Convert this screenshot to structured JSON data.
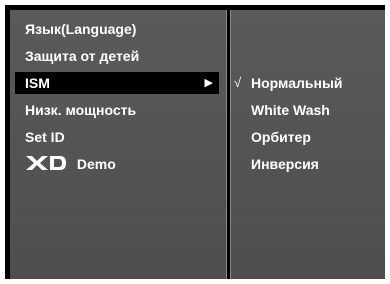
{
  "menu": {
    "items": [
      {
        "label": "Язык(Language)"
      },
      {
        "label": "Защита от детей"
      },
      {
        "label": "ISM",
        "arrow": "▶"
      },
      {
        "label": "Низк. мощность"
      },
      {
        "label": "Set ID"
      },
      {
        "label": "Demo",
        "logo_text": "XD"
      }
    ],
    "selected_index": 2
  },
  "submenu": {
    "check_mark": "√",
    "items": [
      {
        "label": "Нормальный",
        "checked": true
      },
      {
        "label": "White Wash"
      },
      {
        "label": "Орбитер"
      },
      {
        "label": "Инверсия"
      }
    ]
  },
  "colors": {
    "panel_bg": "#555555",
    "selected_bg": "#000000",
    "text": "#ffffff",
    "frame": "#000000"
  },
  "icons": {
    "arrow": "right-triangle-icon",
    "logo": "xd-logo",
    "check": "check-mark-icon"
  }
}
